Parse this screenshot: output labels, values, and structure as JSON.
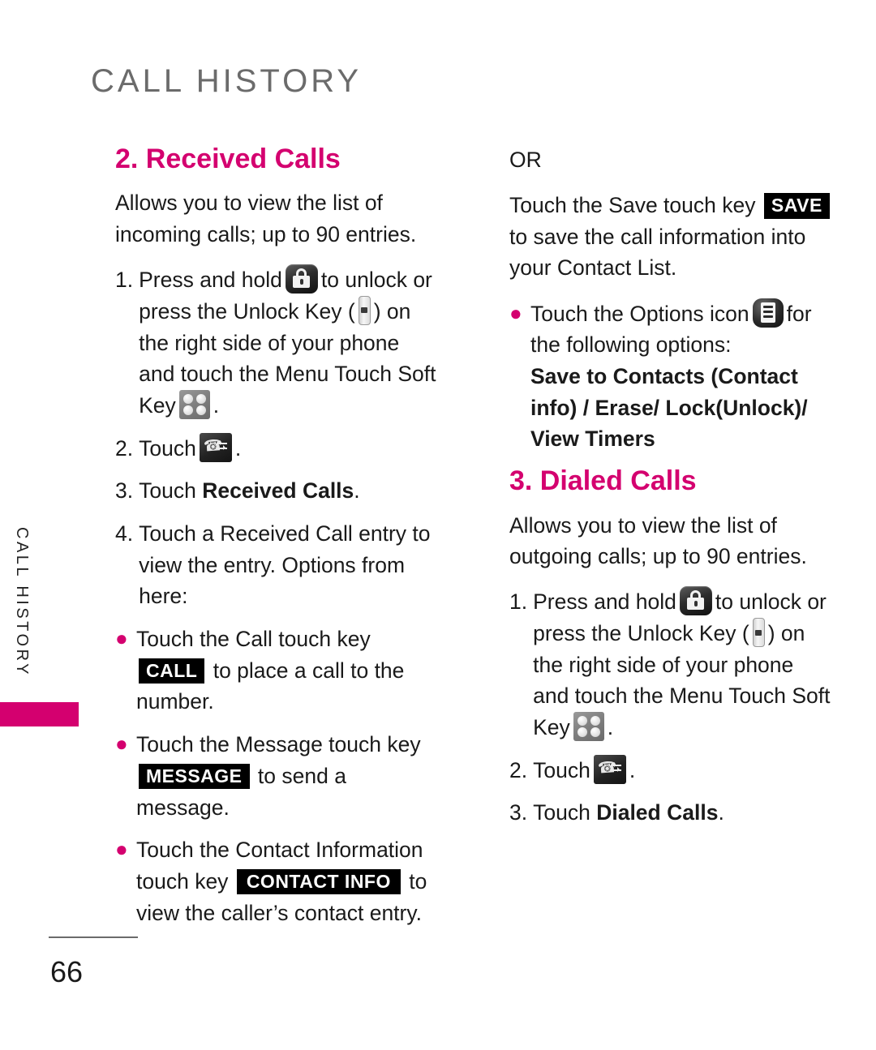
{
  "header": {
    "title": "CALL HISTORY",
    "side_tab_label": "CALL HISTORY"
  },
  "footer": {
    "page_number": "66"
  },
  "colors": {
    "accent": "#d4006f",
    "header_gray": "#6b6b6b",
    "body_text": "#1a1a1a",
    "badge_bg": "#000000",
    "badge_text": "#ffffff"
  },
  "left_column": {
    "section_title": "2. Received Calls",
    "intro": "Allows you to view the list of incoming calls; up to 90 entries.",
    "steps": [
      {
        "num": "1.",
        "text_part_1": "Press and hold",
        "icon_1": "lock-icon",
        "text_part_2": "to unlock or press the Unlock Key (",
        "icon_2": "unlock-key-icon",
        "text_part_3": ") on the right side of your phone and touch the Menu Touch Soft Key",
        "icon_3": "menu-soft-key-icon",
        "text_part_4": "."
      },
      {
        "num": "2.",
        "text_part_1": "Touch",
        "icon_1": "call-history-icon",
        "text_part_2": "."
      },
      {
        "num": "3.",
        "text_part_1": "Touch",
        "bold_text": "Received Calls",
        "text_part_2": "."
      },
      {
        "num": "4.",
        "text_part_1": "Touch a Received Call entry to view the entry. Options from here:"
      }
    ],
    "bullets": [
      {
        "text_part_1": "Touch the Call touch key",
        "badge": "CALL",
        "text_part_2": "to place a call to the number."
      },
      {
        "text_part_1": "Touch the Message touch key",
        "badge": "MESSAGE",
        "text_part_2": "to send a message."
      },
      {
        "text_part_1": "Touch the Contact Information touch key",
        "badge": "CONTACT INFO",
        "text_part_2": "to view the caller’s contact entry."
      }
    ]
  },
  "right_column": {
    "or_label": "OR",
    "save_paragraph": {
      "text_part_1": "Touch the Save touch key",
      "badge": "SAVE",
      "text_part_2": "to save the call information into your Contact List."
    },
    "options_bullet": {
      "text_part_1": "Touch the Options icon",
      "icon_1": "options-icon",
      "text_part_2": "for the following options:",
      "options_text": "Save to Contacts (Contact info) / Erase/ Lock(Unlock)/ View Timers"
    },
    "section_title": "3. Dialed Calls",
    "intro": "Allows you to view the list of outgoing calls; up to 90 entries.",
    "steps": [
      {
        "num": "1.",
        "text_part_1": "Press and hold",
        "icon_1": "lock-icon",
        "text_part_2": "to unlock or press the Unlock Key (",
        "icon_2": "unlock-key-icon",
        "text_part_3": ") on the right side of your phone and touch the Menu Touch Soft Key",
        "icon_3": "menu-soft-key-icon",
        "text_part_4": "."
      },
      {
        "num": "2.",
        "text_part_1": "Touch",
        "icon_1": "call-history-icon",
        "text_part_2": "."
      },
      {
        "num": "3.",
        "text_part_1": "Touch",
        "bold_text": "Dialed Calls",
        "text_part_2": "."
      }
    ]
  }
}
